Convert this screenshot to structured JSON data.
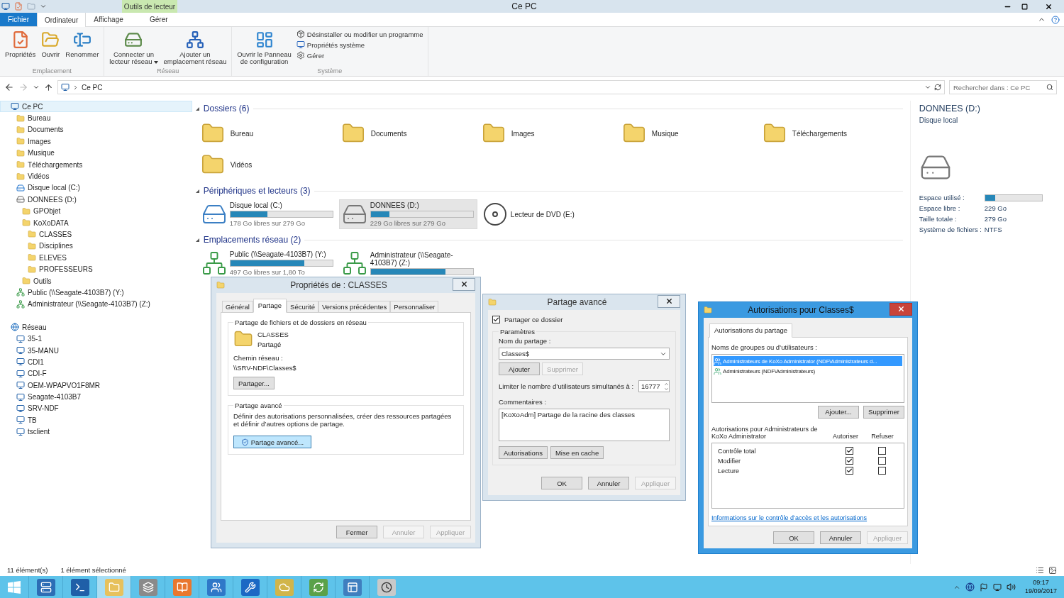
{
  "window": {
    "title": "Ce PC",
    "contextual_group": "Outils de lecteur"
  },
  "ribbon": {
    "tabs": [
      {
        "label": "Fichier",
        "kind": "file",
        "selected": false
      },
      {
        "label": "Ordinateur",
        "kind": "tab",
        "selected": true
      },
      {
        "label": "Affichage",
        "kind": "tab",
        "selected": false
      },
      {
        "label": "Gérer",
        "kind": "contextual",
        "selected": false
      }
    ],
    "groups": [
      {
        "label": "Emplacement",
        "buttons": [
          {
            "kind": "large",
            "lines": [
              "Propriétés"
            ]
          },
          {
            "kind": "large",
            "lines": [
              "Ouvrir"
            ]
          },
          {
            "kind": "large",
            "lines": [
              "Renommer"
            ]
          }
        ]
      },
      {
        "label": "Réseau",
        "buttons": [
          {
            "kind": "large",
            "lines": [
              "Connecter un",
              "lecteur réseau"
            ],
            "dropdown": true
          },
          {
            "kind": "large",
            "lines": [
              "Ajouter un",
              "emplacement réseau"
            ]
          }
        ]
      },
      {
        "label": "Système",
        "buttons": [
          {
            "kind": "large",
            "lines": [
              "Ouvrir le Panneau",
              "de configuration"
            ]
          },
          {
            "kind": "small",
            "lines": [
              "Désinstaller ou modifier un programme"
            ]
          },
          {
            "kind": "small",
            "lines": [
              "Propriétés système"
            ]
          },
          {
            "kind": "small",
            "lines": [
              "Gérer"
            ]
          }
        ]
      }
    ]
  },
  "address": {
    "path": [
      "Ce PC"
    ],
    "search_placeholder": "Rechercher dans : Ce PC"
  },
  "sidebar": {
    "items": [
      {
        "label": "Ce PC",
        "kind": "pc",
        "selected": true,
        "children": [
          {
            "label": "Bureau",
            "kind": "folder",
            "selected": false
          },
          {
            "label": "Documents",
            "kind": "folder",
            "selected": false
          },
          {
            "label": "Images",
            "kind": "folder",
            "selected": false
          },
          {
            "label": "Musique",
            "kind": "folder",
            "selected": false
          },
          {
            "label": "Téléchargements",
            "kind": "folder",
            "selected": false
          },
          {
            "label": "Vidéos",
            "kind": "folder",
            "selected": false
          },
          {
            "label": "Disque local (C:)",
            "kind": "system",
            "selected": false
          },
          {
            "label": "DONNEES (D:)",
            "kind": "drive",
            "selected": false,
            "children": [
              {
                "label": "GPObjet",
                "kind": "folder",
                "selected": false
              },
              {
                "label": "KoXoDATA",
                "kind": "folder",
                "selected": false,
                "children": [
                  {
                    "label": "CLASSES",
                    "kind": "folder",
                    "selected": false
                  },
                  {
                    "label": "Disciplines",
                    "kind": "folder",
                    "selected": false
                  },
                  {
                    "label": "ELEVES",
                    "kind": "folder",
                    "selected": false
                  },
                  {
                    "label": "PROFESSEURS",
                    "kind": "folder",
                    "selected": false
                  }
                ]
              },
              {
                "label": "Outils",
                "kind": "folder",
                "selected": false
              }
            ]
          },
          {
            "label": "Public (\\\\Seagate-4103B7) (Y:)",
            "kind": "netdrive",
            "selected": false
          },
          {
            "label": "Administrateur (\\\\Seagate-4103B7) (Z:)",
            "kind": "netdrive",
            "selected": false
          }
        ]
      },
      {
        "label": "Réseau",
        "kind": "network",
        "selected": false,
        "children": [
          {
            "label": "35-1",
            "kind": "computer",
            "selected": false
          },
          {
            "label": "35-MANU",
            "kind": "computer",
            "selected": false
          },
          {
            "label": "CDI1",
            "kind": "computer",
            "selected": false
          },
          {
            "label": "CDI-F",
            "kind": "computer",
            "selected": false
          },
          {
            "label": "OEM-WPAPVO1F8MR",
            "kind": "computer",
            "selected": false
          },
          {
            "label": "Seagate-4103B7",
            "kind": "computer",
            "selected": false
          },
          {
            "label": "SRV-NDF",
            "kind": "computer",
            "selected": false
          },
          {
            "label": "TB",
            "kind": "computer",
            "selected": false
          },
          {
            "label": "tsclient",
            "kind": "computer",
            "selected": false
          }
        ]
      }
    ]
  },
  "content": {
    "sections": [
      {
        "title": "Dossiers (6)",
        "kind": "folders",
        "expanded": true,
        "items": [
          {
            "name": "Bureau"
          },
          {
            "name": "Documents"
          },
          {
            "name": "Images"
          },
          {
            "name": "Musique"
          },
          {
            "name": "Téléchargements"
          },
          {
            "name": "Vidéos"
          }
        ]
      },
      {
        "title": "Périphériques et lecteurs (3)",
        "kind": "drives",
        "expanded": true,
        "items": [
          {
            "kind": "system",
            "name": "Disque local (C:)",
            "level": 0.36,
            "free": "178 Go libres sur 279 Go",
            "selected": false
          },
          {
            "kind": "disk",
            "name": "DONNEES (D:)",
            "level": 0.18,
            "free": "229 Go libres sur 279 Go",
            "selected": true
          },
          {
            "kind": "dvd",
            "name": "Lecteur de DVD (E:)",
            "selected": false
          }
        ]
      },
      {
        "title": "Emplacements réseau (2)",
        "kind": "drives",
        "expanded": true,
        "items": [
          {
            "kind": "network",
            "name": "Public (\\\\Seagate-4103B7) (Y:)",
            "level": 0.72,
            "free": "497 Go libres sur 1,80 To",
            "selected": false
          },
          {
            "kind": "network",
            "name": "Administrateur (\\\\Seagate-4103B7) (Z:)",
            "level": 0.73,
            "selected": false
          }
        ]
      }
    ]
  },
  "details": {
    "title": "DONNEES (D:)",
    "subtitle": "Disque local",
    "properties": [
      {
        "label": "Espace utilisé :",
        "kind": "bar",
        "level": 0.18
      },
      {
        "label": "Espace libre :",
        "kind": "text",
        "value": "229 Go"
      },
      {
        "label": "Taille totale :",
        "kind": "text",
        "value": "279 Go"
      },
      {
        "label": "Système de fichiers :",
        "kind": "text",
        "value": "NTFS"
      }
    ]
  },
  "status_bar": {
    "items": [
      "11 élément(s)",
      "1 élément sélectionné"
    ]
  },
  "dialogs": {
    "properties": {
      "title": "Propriétés de : CLASSES",
      "active": false,
      "tabs": [
        {
          "label": "Général",
          "selected": false
        },
        {
          "label": "Partage",
          "selected": true
        },
        {
          "label": "Sécurité",
          "selected": false
        },
        {
          "label": "Versions précédentes",
          "selected": false
        },
        {
          "label": "Personnaliser",
          "selected": false
        }
      ],
      "network_share": {
        "heading": "Partage de fichiers et de dossiers en réseau",
        "name": "CLASSES",
        "status": "Partagé",
        "path_label": "Chemin réseau :",
        "path": "\\\\SRV-NDF\\Classes$",
        "button": "Partager..."
      },
      "advanced": {
        "heading": "Partage avancé",
        "description": "Définir des autorisations personnalisées, créer des ressources partagées et définir d’autres options de partage.",
        "button": {
          "label": "Partage avancé...",
          "highlighted": true
        }
      },
      "buttons": [
        {
          "label": "Fermer",
          "disabled": false
        },
        {
          "label": "Annuler",
          "disabled": true
        },
        {
          "label": "Appliquer",
          "disabled": true
        }
      ]
    },
    "advanced_sharing": {
      "title": "Partage avancé",
      "active": false,
      "share_checkbox": {
        "label": "Partager ce dossier",
        "checked": true
      },
      "settings_heading": "Paramètres",
      "share_name_label": "Nom du partage :",
      "share_name": "Classes$",
      "name_buttons": [
        {
          "label": "Ajouter",
          "disabled": false
        },
        {
          "label": "Supprimer",
          "disabled": true
        }
      ],
      "limit_label": "Limiter le nombre d’utilisateurs simultanés à :",
      "limit_value": "16777",
      "comments_label": "Commentaires :",
      "comments": "[KoXoAdm] Partage de la racine des classes",
      "option_buttons": [
        {
          "label": "Autorisations",
          "disabled": false
        },
        {
          "label": "Mise en cache",
          "disabled": false
        }
      ],
      "buttons": [
        {
          "label": "OK",
          "disabled": false
        },
        {
          "label": "Annuler",
          "disabled": false
        },
        {
          "label": "Appliquer",
          "disabled": true
        }
      ]
    },
    "permissions": {
      "title": "Autorisations pour Classes$",
      "active": true,
      "tabs": [
        {
          "label": "Autorisations du partage",
          "selected": true
        }
      ],
      "users_label": "Noms de groupes ou d’utilisateurs :",
      "users": [
        {
          "name": "Administrateurs de KoXo Administrator (NDF\\Administrateurs d...",
          "selected": true
        },
        {
          "name": "Administrateurs (NDF\\Administrateurs)",
          "selected": false
        }
      ],
      "user_buttons": [
        {
          "label": "Ajouter...",
          "disabled": false
        },
        {
          "label": "Supprimer",
          "disabled": false
        }
      ],
      "permissions_label": "Autorisations pour Administrateurs de KoXo Administrator",
      "columns": [
        "Autoriser",
        "Refuser"
      ],
      "rows": [
        {
          "label": "Contrôle total",
          "allow": true,
          "deny": false
        },
        {
          "label": "Modifier",
          "allow": true,
          "deny": false
        },
        {
          "label": "Lecture",
          "allow": true,
          "deny": false
        }
      ],
      "link": "Informations sur le contrôle d’accès et les autorisations",
      "buttons": [
        {
          "label": "OK",
          "disabled": false
        },
        {
          "label": "Annuler",
          "disabled": false
        },
        {
          "label": "Appliquer",
          "disabled": true
        }
      ]
    }
  },
  "taskbar": {
    "apps": [
      {
        "selected": false
      },
      {
        "selected": false
      },
      {
        "selected": true
      },
      {
        "selected": false
      },
      {
        "selected": false
      },
      {
        "selected": false
      },
      {
        "selected": false
      },
      {
        "selected": false
      },
      {
        "selected": false
      },
      {
        "selected": false
      },
      {
        "selected": false
      }
    ],
    "time": "09:17",
    "date": "19/09/2017"
  }
}
